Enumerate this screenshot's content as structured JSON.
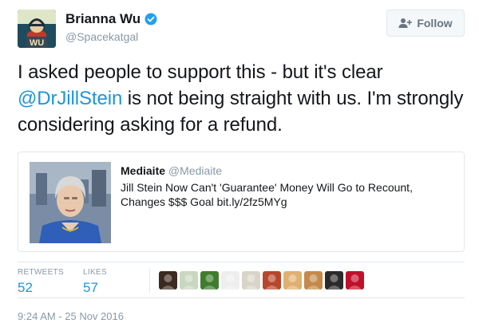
{
  "author": {
    "display_name": "Brianna Wu",
    "handle": "@Spacekatgal",
    "verified": true,
    "avatar_text": "WU",
    "avatar_icon": "user-avatar"
  },
  "follow_button": {
    "label": "Follow",
    "icon": "add-user-icon"
  },
  "tweet": {
    "text_before": "I asked people to support this - but it's clear ",
    "mention": "@DrJillStein",
    "text_after": " is not being straight with us. I'm strongly considering asking for a refund."
  },
  "quote": {
    "author": "Mediaite",
    "handle": "@Mediaite",
    "text": "Jill Stein Now Can't 'Guarantee' Money Will Go to Recount, Changes $$$ Goal bit.ly/2fz5MYg",
    "image_icon": "news-thumbnail"
  },
  "stats": {
    "retweets_label": "RETWEETS",
    "retweets_value": "52",
    "likes_label": "LIKES",
    "likes_value": "57"
  },
  "likers": [
    {
      "name": "liker-1",
      "color": "#3b2a20"
    },
    {
      "name": "liker-2",
      "color": "#c9d6c0"
    },
    {
      "name": "liker-3",
      "color": "#3f7d2e"
    },
    {
      "name": "liker-4",
      "color": "#eeeeee"
    },
    {
      "name": "liker-5",
      "color": "#d9d4c8"
    },
    {
      "name": "liker-6",
      "color": "#b7472a"
    },
    {
      "name": "liker-7",
      "color": "#e0b070"
    },
    {
      "name": "liker-8",
      "color": "#c58a4a"
    },
    {
      "name": "liker-9",
      "color": "#2b2b2b"
    },
    {
      "name": "liker-10",
      "color": "#c0102a"
    }
  ],
  "timestamp": "9:24 AM - 25 Nov 2016",
  "colors": {
    "link": "#1b95e0",
    "muted": "#8899a6",
    "border": "#e1e8ed"
  }
}
